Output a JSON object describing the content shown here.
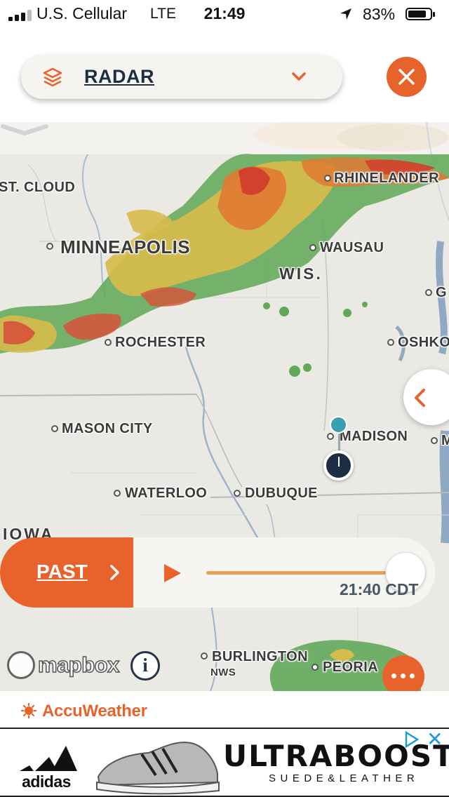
{
  "status_bar": {
    "carrier": "U.S. Cellular",
    "network": "LTE",
    "time": "21:49",
    "battery_pct_text": "83%",
    "battery_level": 0.83,
    "signal_bars_filled": 3,
    "signal_bars_total": 4
  },
  "header": {
    "layer_label": "RADAR",
    "icons": [
      "layers-icon",
      "chevron-down-icon",
      "close-icon"
    ]
  },
  "map": {
    "cities": [
      {
        "id": "st-cloud",
        "label": "ST. CLOUD"
      },
      {
        "id": "rhinelander",
        "label": "RHINELANDER"
      },
      {
        "id": "minneapolis",
        "label": "MINNEAPOLIS"
      },
      {
        "id": "wausau",
        "label": "WAUSAU"
      },
      {
        "id": "green-bay",
        "label": "G"
      },
      {
        "id": "rochester",
        "label": "ROCHESTER"
      },
      {
        "id": "oshkosh",
        "label": "OSHKO"
      },
      {
        "id": "mason-city",
        "label": "MASON CITY"
      },
      {
        "id": "madison",
        "label": "MADISON"
      },
      {
        "id": "milwaukee",
        "label": "M"
      },
      {
        "id": "waterloo",
        "label": "WATERLOO"
      },
      {
        "id": "dubuque",
        "label": "DUBUQUE"
      },
      {
        "id": "burlington",
        "label": "BURLINGTON"
      },
      {
        "id": "peoria",
        "label": "PEORIA"
      }
    ],
    "state_labels": {
      "wis": "WIS.",
      "iowa": "IOWA"
    },
    "nws_label": "NWS",
    "attribution": "mapbox",
    "info_glyph": "i",
    "colors": {
      "accent": "#e8632c",
      "navy": "#1d2d44",
      "pin": "#3a9fae",
      "land": "#ebe9e4"
    }
  },
  "timeline": {
    "mode_label": "PAST",
    "timestamp": "21:40 CDT",
    "progress": 1.0
  },
  "footer": {
    "brand": "AccuWeather"
  },
  "ad": {
    "advertiser": "adidas",
    "title": "ULTRABOOST",
    "subtitle": "SUEDE&LEATHER",
    "close_glyph": "✕"
  }
}
